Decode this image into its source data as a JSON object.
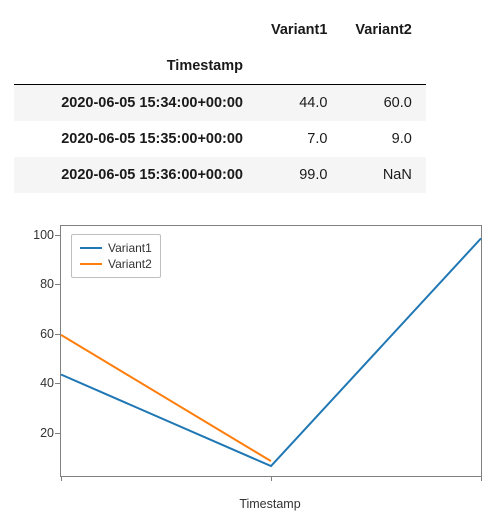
{
  "table": {
    "columns": [
      "Variant1",
      "Variant2"
    ],
    "index_name": "Timestamp",
    "rows": [
      {
        "ts": "2020-06-05 15:34:00+00:00",
        "v1": "44.0",
        "v2": "60.0"
      },
      {
        "ts": "2020-06-05 15:35:00+00:00",
        "v1": "7.0",
        "v2": "9.0"
      },
      {
        "ts": "2020-06-05 15:36:00+00:00",
        "v1": "99.0",
        "v2": "NaN"
      }
    ]
  },
  "chart_data": {
    "type": "line",
    "categories": [
      "2020-06-05 15:34:00+00:00",
      "2020-06-05 15:35:00+00:00",
      "2020-06-05 15:36:00+00:00"
    ],
    "series": [
      {
        "name": "Variant1",
        "values": [
          44.0,
          7.0,
          99.0
        ],
        "color": "#1f77b4"
      },
      {
        "name": "Variant2",
        "values": [
          60.0,
          9.0,
          null
        ],
        "color": "#ff7f0e"
      }
    ],
    "xlabel": "Timestamp",
    "ylabel": "",
    "yticks": [
      20,
      40,
      60,
      80,
      100
    ],
    "ylim": [
      3,
      104
    ],
    "legend_position": "upper-left"
  }
}
